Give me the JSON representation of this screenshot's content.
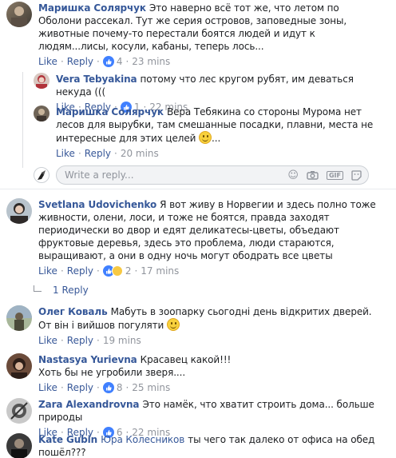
{
  "comments": [
    {
      "author": "Маришка Солярчук",
      "text": "Это наверно всё тот же, что летом по Оболони рассекал. Тут же серия островов, заповедные зоны, животные почему-то перестали боятся людей и идут к людям...лисы, косули, кабаны, теперь лось...",
      "like": "Like",
      "reply": "Reply",
      "reactions": "4",
      "time": "23 mins"
    },
    {
      "author": "Vera Tebyakina",
      "text": "потому что лес кругом рубят, им деваться некуда (((",
      "like": "Like",
      "reply": "Reply",
      "reactions": "1",
      "time": "22 mins"
    },
    {
      "author": "Маришка Солярчук",
      "text": "Вера Тебякина со стороны Мурома нет лесов для вырубки, там смешанные посадки, плавни, места не интересные для этих целей",
      "text_tail": "...",
      "like": "Like",
      "reply": "Reply",
      "time": "20 mins"
    },
    {
      "author": "Svetlana Udovichenko",
      "text": "Я вот живу в Норвегии и здесь полно тоже живности, олени, лоси, и тоже не боятся, правда заходят периодически во двор и едят деликатесы-цветы, объедают фруктовые деревья, здесь это проблема, люди стараются, выращивают, а они в одну ночь могут ободрать все цветы",
      "like": "Like",
      "reply": "Reply",
      "reactions": "2",
      "time": "17 mins",
      "replies_link": "1 Reply"
    },
    {
      "author": "Олег Коваль",
      "text": "Мабуть в зоопарку сьогодні день відкритих дверей. От він і вийшов погуляти",
      "like": "Like",
      "reply": "Reply",
      "time": "19 mins"
    },
    {
      "author": "Nastasya Yurievna",
      "text": "Красавец какой!!!",
      "text2": "Хоть бы не угробили зверя....",
      "like": "Like",
      "reply": "Reply",
      "reactions": "8",
      "time": "25 mins"
    },
    {
      "author": "Zara Alexandrovna",
      "text": "Это намёк, что хватит строить дома... больше природы",
      "like": "Like",
      "reply": "Reply",
      "reactions": "6",
      "time": "22 mins"
    },
    {
      "author": "Kate Gubin",
      "mention": "Юра Колесников",
      "text": "ты чего так далеко от офиса на обед пошёл???"
    }
  ],
  "reply_input": {
    "placeholder": "Write a reply..."
  },
  "colors": {
    "link": "#385898",
    "author": "#365899",
    "meta": "#90949c",
    "like_blue": "#4080ff"
  },
  "icons": [
    "like-icon",
    "haha-icon",
    "smiley-icon",
    "camera-icon",
    "gif-icon",
    "sticker-icon",
    "reply-arrow-icon"
  ]
}
